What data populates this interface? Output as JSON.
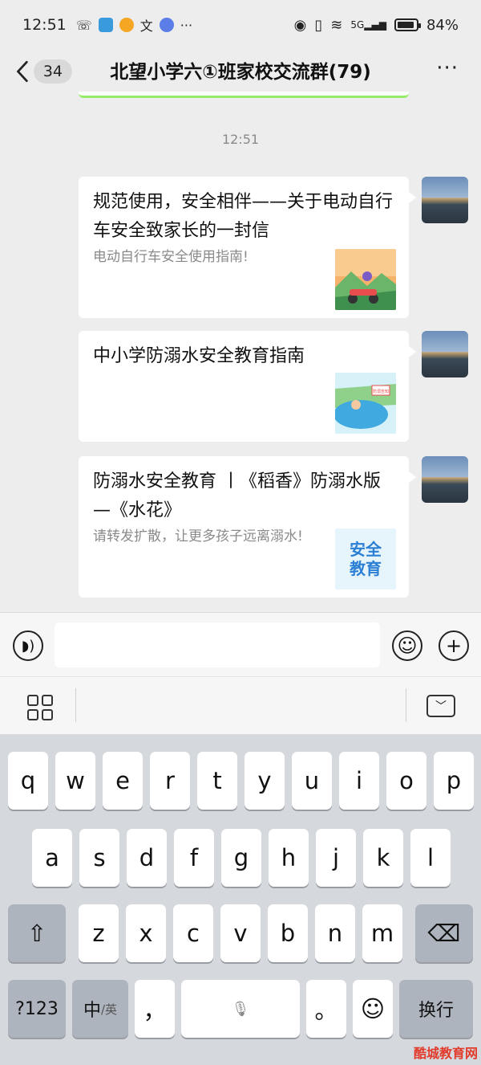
{
  "status_bar": {
    "time": "12:51",
    "battery": "84%",
    "network": "5G",
    "dots": "···"
  },
  "header": {
    "back_badge": "34",
    "title": "北望小学六①班家校交流群(79)",
    "more": "···"
  },
  "chat": {
    "timestamp": "12:51",
    "messages": [
      {
        "title": "规范使用，安全相伴——关于电动自行车安全致家长的一封信",
        "desc": "电动自行车安全使用指南!",
        "thumb": "ebike-thumbnail"
      },
      {
        "title": "中小学防溺水安全教育指南",
        "desc": "",
        "thumb": "swimming-thumbnail",
        "thumb_sign": "防溺告知"
      },
      {
        "title": "防溺水安全教育 丨《稻香》防溺水版—《水花》",
        "desc": "请转发扩散，让更多孩子远离溺水!",
        "thumb": "safety-education-thumbnail",
        "thumb_text": "安全教育"
      }
    ]
  },
  "input_bar": {
    "placeholder": ""
  },
  "keyboard": {
    "row1": [
      "q",
      "w",
      "e",
      "r",
      "t",
      "y",
      "u",
      "i",
      "o",
      "p"
    ],
    "row2": [
      "a",
      "s",
      "d",
      "f",
      "g",
      "h",
      "j",
      "k",
      "l"
    ],
    "row3": [
      "z",
      "x",
      "c",
      "v",
      "b",
      "n",
      "m"
    ],
    "num_key": "?123",
    "lang_key": "中",
    "lang_sub": "/英",
    "comma": "，",
    "period": "。",
    "enter_key": "换行"
  },
  "watermark": "酷城教育网",
  "colors": {
    "accent_green": "#95ec69",
    "chat_bg": "#ededed",
    "keyboard_bg": "#d5d8dd"
  }
}
